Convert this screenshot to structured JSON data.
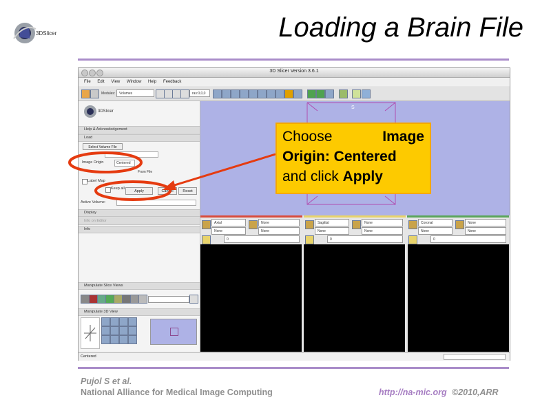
{
  "slide": {
    "title": "Loading a Brain File",
    "logo_text": "3DSlicer",
    "footer_author": "Pujol S et al.",
    "footer_org": "National Alliance for Medical Image Computing",
    "footer_url": "http://na-mic.org",
    "footer_copy": "©2010,ARR",
    "accent": "#a98cc9"
  },
  "window": {
    "title": "3D Slicer Version 3.6.1",
    "menu": [
      "File",
      "Edit",
      "View",
      "Window",
      "Help",
      "Feedback"
    ],
    "modules_label": "Modules:",
    "modules_value": "Volumes",
    "toolbar_field": "ras:0,0,0"
  },
  "panel": {
    "logo": "3DSlicer",
    "help_section": "Help & Acknowledgement",
    "load_section": "Load",
    "select_file_button": "Select Volume File",
    "image_origin_label": "Image Origin",
    "image_origin_value": "Centered",
    "preset_value": "From File",
    "label_map_label": "Label Map",
    "keep_all_label": "Keep all",
    "apply_button": "Apply",
    "cancel_button": "Cancel",
    "reset_button": "Reset",
    "active_volume_label": "Active Volume:",
    "display_section": "Display",
    "editor_section": "Info on Editor",
    "info_section": "Info",
    "manip_slice_section": "Manipulate Slice Views",
    "manip_3d_section": "Manipulate 3D View"
  },
  "views": {
    "s_label": "S",
    "red": {
      "orientation": "Axial",
      "fg": "None",
      "bg": "None",
      "offset": "0",
      "color": "#d94b3b"
    },
    "yellow": {
      "orientation": "Sagittal",
      "fg": "None",
      "bg": "None",
      "offset": "0",
      "color": "#e8d36a"
    },
    "green": {
      "orientation": "Coronal",
      "fg": "None",
      "bg": "None",
      "offset": "0",
      "color": "#5aa55a"
    }
  },
  "status": {
    "text": "Centered"
  },
  "callout": {
    "line1a": "Choose",
    "line1b": "Image",
    "line2": "Origin: Centered",
    "line3a": "and click",
    "line3b": "Apply",
    "bg": "#fdca00"
  }
}
